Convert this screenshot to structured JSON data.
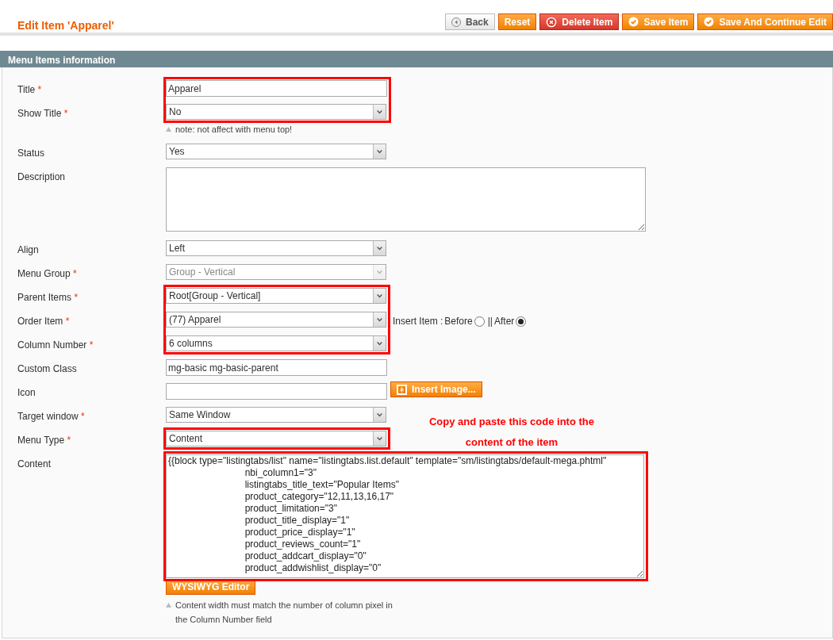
{
  "page_title": "Edit Item 'Apparel'",
  "buttons": [
    {
      "label": "Back",
      "kind": "back"
    },
    {
      "label": "Reset",
      "kind": "plain"
    },
    {
      "label": "Delete Item",
      "kind": "delete"
    },
    {
      "label": "Save Item",
      "kind": "save"
    },
    {
      "label": "Save And Continue Edit",
      "kind": "save"
    }
  ],
  "section_title": "Menu Items information",
  "fields": [
    {
      "kind": "highlight",
      "fields": [
        {
          "kind": "text",
          "label": "Title",
          "required_mark": "*",
          "value": "Apparel"
        },
        {
          "kind": "select",
          "label": "Show Title",
          "required_mark": "*",
          "value": "No",
          "disabled": false,
          "note": "note: not affect with menu top!"
        }
      ]
    },
    {
      "kind": "select",
      "label": "Status",
      "value": "Yes",
      "disabled": false
    },
    {
      "kind": "textarea",
      "label": "Description"
    },
    {
      "kind": "select",
      "label": "Align",
      "value": "Left",
      "disabled": false
    },
    {
      "kind": "select",
      "label": "Menu Group",
      "required_mark": "*",
      "value": "Group - Vertical",
      "disabled": true
    },
    {
      "kind": "highlight",
      "fields": [
        {
          "kind": "select",
          "label": "Parent Items",
          "required_mark": "*",
          "value": "Root[Group - Vertical]",
          "disabled": false
        },
        {
          "kind": "select",
          "label": "Order Item",
          "required_mark": "*",
          "value": "(77) Apparel",
          "disabled": false,
          "insert_position": {
            "label": "Insert Item :",
            "separator": "||",
            "options": [
              {
                "label": "Before",
                "selected": false
              },
              {
                "label": "After",
                "selected": true
              }
            ]
          }
        },
        {
          "kind": "select",
          "label": "Column Number",
          "required_mark": "*",
          "value": "6 columns",
          "disabled": false
        }
      ]
    },
    {
      "kind": "text",
      "label": "Custom Class",
      "value": "mg-basic mg-basic-parent"
    },
    {
      "kind": "image",
      "label": "Icon",
      "button": "Insert Image..."
    },
    {
      "kind": "select",
      "label": "Target window",
      "required_mark": "*",
      "value": "Same Window",
      "disabled": false
    },
    {
      "kind": "highlight",
      "fields": [
        {
          "kind": "select",
          "label": "Menu Type",
          "required_mark": "*",
          "value": "Content",
          "disabled": false,
          "annotation": "Copy and paste this code into the content of the item"
        }
      ]
    },
    {
      "kind": "highlight",
      "fields": [
        {
          "kind": "code",
          "label": "Content",
          "value": "{{block type=\"listingtabs/list\" name=\"listingtabs.list.default\" template=\"sm/listingtabs/default-mega.phtml\"\n                             nbi_column1=\"3\"\n                             listingtabs_title_text=\"Popular Items\"\n                             product_category=\"12,11,13,16,17\"\n                             product_limitation=\"3\"\n                             product_title_display=\"1\"\n                             product_price_display=\"1\"\n                             product_reviews_count=\"1\"\n                             product_addcart_display=\"0\"\n                             product_addwishlist_display=\"0\"",
          "button": "WYSIWYG Editor",
          "note": "Content width must match the number of column pixel in the Column Number field"
        }
      ]
    }
  ]
}
